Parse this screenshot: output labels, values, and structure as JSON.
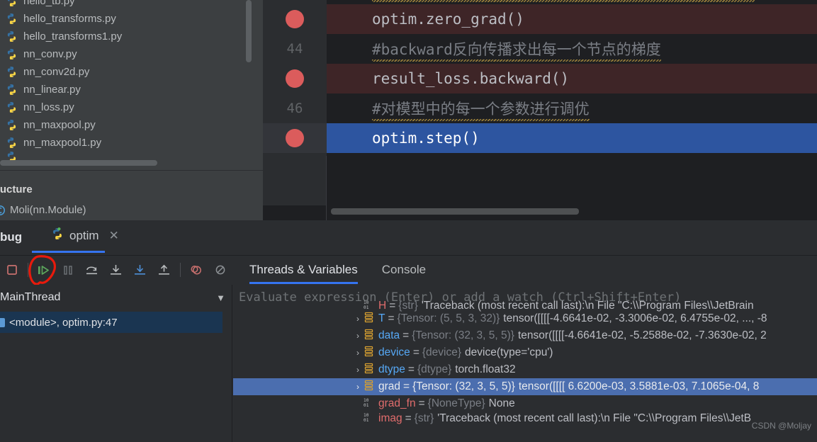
{
  "file_tree": {
    "items": [
      {
        "label": "hello_tb.py",
        "icon": "python-file-icon",
        "partial": true
      },
      {
        "label": "hello_tb.py",
        "icon": "python-file-icon"
      },
      {
        "label": "hello_transforms.py",
        "icon": "python-file-icon"
      },
      {
        "label": "hello_transforms1.py",
        "icon": "python-file-icon"
      },
      {
        "label": "nn_conv.py",
        "icon": "python-file-icon"
      },
      {
        "label": "nn_conv2d.py",
        "icon": "python-file-icon"
      },
      {
        "label": "nn_linear.py",
        "icon": "python-file-icon"
      },
      {
        "label": "nn_loss.py",
        "icon": "python-file-icon"
      },
      {
        "label": "nn_maxpool.py",
        "icon": "python-file-icon"
      },
      {
        "label": "nn_maxpool1.py",
        "icon": "python-file-icon"
      }
    ]
  },
  "structure": {
    "title": "ructure",
    "item_label": "Moli(nn.Module)",
    "item_icon": "class-icon"
  },
  "editor": {
    "lines": [
      {
        "number": "",
        "breakpoint": true,
        "current": false,
        "text": "optim.zero_grad()",
        "kind": "code"
      },
      {
        "number": "44",
        "breakpoint": false,
        "current": false,
        "text": "#backward反向传播求出每一个节点的梯度",
        "kind": "comment"
      },
      {
        "number": "",
        "breakpoint": true,
        "current": false,
        "text": "result_loss.backward()",
        "kind": "code"
      },
      {
        "number": "46",
        "breakpoint": false,
        "current": false,
        "text": "#对模型中的每一个参数进行调优",
        "kind": "comment"
      },
      {
        "number": "",
        "breakpoint": true,
        "current": true,
        "text": "optim.step()",
        "kind": "code"
      }
    ]
  },
  "debug": {
    "window_title": "bug",
    "tab_label": "optim",
    "tab_icon": "python-file-icon",
    "close_icon": "close-icon",
    "toolbar": [
      {
        "name": "stop-button",
        "icon": "stop-icon"
      },
      {
        "name": "resume-button",
        "icon": "resume-icon"
      },
      {
        "name": "pause-button",
        "icon": "pause-icon"
      },
      {
        "name": "step-over-button",
        "icon": "step-over-icon"
      },
      {
        "name": "step-into-button",
        "icon": "step-into-icon"
      },
      {
        "name": "force-step-into-button",
        "icon": "force-step-into-icon"
      },
      {
        "name": "step-out-button",
        "icon": "step-out-icon"
      },
      {
        "name": "view-breakpoints-button",
        "icon": "breakpoints-icon"
      },
      {
        "name": "mute-breakpoints-button",
        "icon": "mute-breakpoints-icon"
      },
      {
        "name": "more-options-button",
        "icon": "more-vertical-icon"
      }
    ],
    "tabs": [
      {
        "label": "Threads & Variables",
        "selected": true
      },
      {
        "label": "Console",
        "selected": false
      }
    ],
    "thread": "MainThread",
    "thread_chevron": "chevron-down-icon",
    "frames": [
      {
        "label": "<module>, optim.py:47",
        "selected": true
      }
    ]
  },
  "variables": {
    "evaluate_placeholder": "Evaluate expression (Enter) or add a watch (Ctrl+Shift+Enter)",
    "rows": [
      {
        "clipped": "top",
        "expandable": false,
        "icon": "string-var-icon",
        "icon_kind": "binary",
        "name": "H",
        "name_color": "red",
        "type": "{str}",
        "value": "'Traceback (most recent call last):\\n  File \"C:\\\\Program Files\\\\JetBrain",
        "selected": false
      },
      {
        "clipped": "none",
        "expandable": true,
        "icon": "object-var-icon",
        "icon_kind": "object",
        "name": "T",
        "name_color": "blue",
        "type": "{Tensor: (5, 5, 3, 32)}",
        "value": "tensor([[[[-4.6641e-02, -3.3006e-02,  6.4755e-02,  ..., -8",
        "selected": false
      },
      {
        "clipped": "none",
        "expandable": true,
        "icon": "object-var-icon",
        "icon_kind": "object",
        "name": "data",
        "name_color": "blue",
        "type": "{Tensor: (32, 3, 5, 5)}",
        "value": "tensor([[[[-4.6641e-02, -5.2588e-02, -7.3630e-02,  2",
        "selected": false
      },
      {
        "clipped": "none",
        "expandable": true,
        "icon": "object-var-icon",
        "icon_kind": "object",
        "name": "device",
        "name_color": "blue",
        "type": "{device}",
        "value": "device(type='cpu')",
        "selected": false
      },
      {
        "clipped": "none",
        "expandable": true,
        "icon": "object-var-icon",
        "icon_kind": "object",
        "name": "dtype",
        "name_color": "blue",
        "type": "{dtype}",
        "value": "torch.float32",
        "selected": false
      },
      {
        "clipped": "none",
        "expandable": true,
        "icon": "object-var-icon",
        "icon_kind": "object",
        "name": "grad",
        "name_color": "blue",
        "type": "{Tensor: (32, 3, 5, 5)}",
        "value": "tensor([[[[ 6.6200e-03,  3.5881e-03,  7.1065e-04,  8",
        "selected": true
      },
      {
        "clipped": "none",
        "expandable": false,
        "icon": "binary-var-icon",
        "icon_kind": "binary",
        "name": "grad_fn",
        "name_color": "red",
        "type": "{NoneType}",
        "value": "None",
        "selected": false
      },
      {
        "clipped": "bottom",
        "expandable": false,
        "icon": "binary-var-icon",
        "icon_kind": "binary",
        "name": "imag",
        "name_color": "red",
        "type": "{str}",
        "value": "'Traceback (most recent call last):\\n  File \"C:\\\\Program Files\\\\JetB",
        "selected": false
      }
    ]
  },
  "watermark": "CSDN @Moljay",
  "colors": {
    "accent_blue": "#3574f0",
    "current_line": "#2d55a0",
    "breakpoint_line": "#3e2527",
    "breakpoint_dot": "#db5c5c",
    "selection_blue": "#4b6eaf",
    "panel_bg": "#2b2d30",
    "tree_bg": "#3c3f41",
    "editor_bg": "#1e1f22",
    "annotation_red": "#e81a0c"
  }
}
